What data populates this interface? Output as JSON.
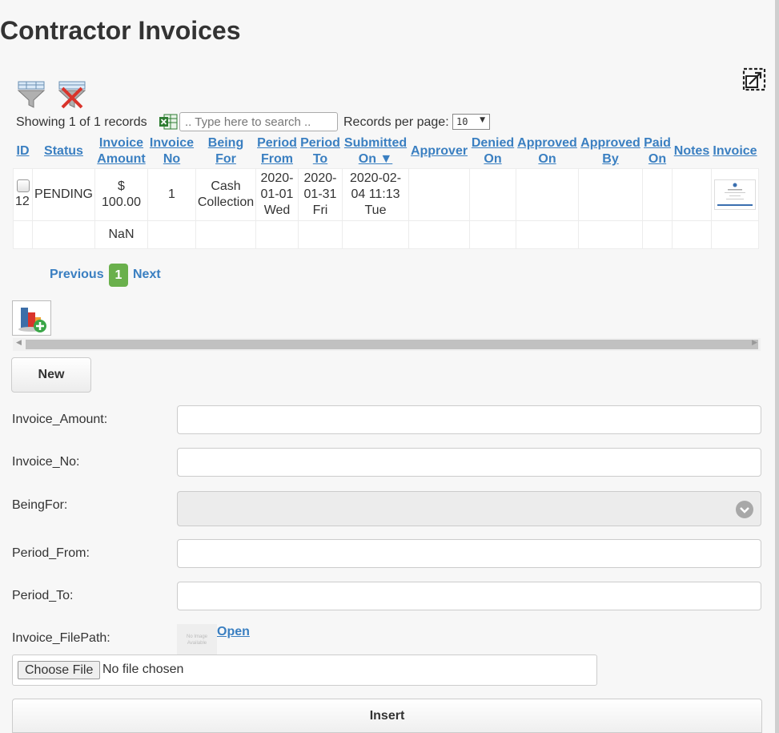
{
  "page": {
    "title": "Contractor Invoices"
  },
  "toolbar": {
    "filter_icon": "funnel-icon",
    "clear_filter_icon": "funnel-clear-icon",
    "summary": "Showing 1 of 1 records",
    "excel_icon": "excel-export-icon",
    "search_placeholder": ".. Type here to search ..",
    "rpp_label": "Records per page:",
    "rpp_value": "10"
  },
  "table": {
    "headers": [
      {
        "l1": "ID",
        "l2": ""
      },
      {
        "l1": "Status",
        "l2": ""
      },
      {
        "l1": "Invoice",
        "l2": "Amount"
      },
      {
        "l1": "Invoice",
        "l2": "No"
      },
      {
        "l1": "Being",
        "l2": "For"
      },
      {
        "l1": "Period",
        "l2": "From"
      },
      {
        "l1": "Period",
        "l2": "To"
      },
      {
        "l1": "Submitted",
        "l2": "On ▼"
      },
      {
        "l1": "Approver",
        "l2": ""
      },
      {
        "l1": "Denied",
        "l2": "On"
      },
      {
        "l1": "Approved",
        "l2": "On"
      },
      {
        "l1": "Approved",
        "l2": "By"
      },
      {
        "l1": "Paid",
        "l2": "On"
      },
      {
        "l1": "Notes",
        "l2": ""
      },
      {
        "l1": "Invoice",
        "l2": ""
      }
    ],
    "rows": [
      {
        "id": "12",
        "status": "PENDING",
        "amount": [
          "$",
          "100.00"
        ],
        "invoice_no": "1",
        "being_for": [
          "Cash",
          "Collection"
        ],
        "period_from": [
          "2020-",
          "01-01",
          "Wed"
        ],
        "period_to": [
          "2020-",
          "01-31",
          "Fri"
        ],
        "submitted_on": [
          "2020-02-",
          "04 11:13",
          "Tue"
        ],
        "approver": "",
        "denied_on": "",
        "approved_on": "",
        "approved_by": "",
        "paid_on": "",
        "notes": ""
      }
    ],
    "total_amount": "NaN"
  },
  "pager": {
    "previous": "Previous",
    "current": "1",
    "next": "Next"
  },
  "chart_button_icon": "add-chart-icon",
  "form": {
    "new_label": "New",
    "fields": {
      "invoice_amount": "Invoice_Amount:",
      "invoice_no": "Invoice_No:",
      "being_for": "BeingFor:",
      "period_from": "Period_From:",
      "period_to": "Period_To:",
      "file_path": "Invoice_FilePath:"
    },
    "no_image_text": "No Image Available",
    "open_label": "Open",
    "choose_file": "Choose File",
    "file_status": "No file chosen",
    "insert_label": "Insert"
  },
  "colors": {
    "link": "#3a7fc1",
    "page_active": "#6ab04c",
    "background": "#f7f7f7"
  }
}
